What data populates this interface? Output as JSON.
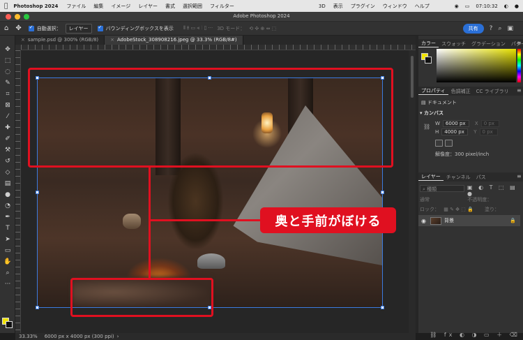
{
  "menubar": {
    "app": "Photoshop 2024",
    "items": [
      "ファイル",
      "編集",
      "イメージ",
      "レイヤー",
      "書式",
      "選択範囲",
      "フィルター",
      "3D",
      "表示",
      "プラグイン",
      "ウィンドウ",
      "ヘルプ"
    ],
    "clock": "07:10:32"
  },
  "window": {
    "title": "Adobe Photoshop 2024"
  },
  "options": {
    "auto_select_label": "自動選択：",
    "auto_select_value": "レイヤー",
    "bounding_box_label": "バウンディングボックスを表示",
    "mode3d": "3D モード：",
    "share": "共有"
  },
  "tabs": [
    {
      "label": "sample.psd @ 300% (RGB/8)",
      "active": false
    },
    {
      "label": "AdobeStock_308908216.jpeg @ 33.3% (RGB/8#)",
      "active": true
    }
  ],
  "annotation": {
    "callout": "奥と手前がぼける"
  },
  "panels": {
    "color_tabs": [
      "カラー",
      "スウォッチ",
      "グラデーション",
      "パターン"
    ],
    "fg_color": "#f1e400",
    "bg_color": "#111111",
    "prop_tabs": [
      "プロパティ",
      "色調補正",
      "CC ライブラリ"
    ],
    "doc_label": "ドキュメント",
    "canvas_section": "カンバス",
    "w_label": "W",
    "w_value": "6000 px",
    "x_label": "X",
    "x_value": "0 px",
    "h_label": "H",
    "h_value": "4000 px",
    "y_label": "Y",
    "y_value": "0 px",
    "resolution": "解像度：300 pixel/inch",
    "layer_tabs": [
      "レイヤー",
      "チャンネル",
      "パス"
    ],
    "layer_search": "種類",
    "blend_mode": "通常",
    "opacity_label": "不透明度：",
    "lock_label": "ロック：",
    "fill_label": "塗り：",
    "layer_name": "背景"
  },
  "status": {
    "zoom": "33.33%",
    "info": "6000 px x 4000 px (300 ppi)"
  }
}
